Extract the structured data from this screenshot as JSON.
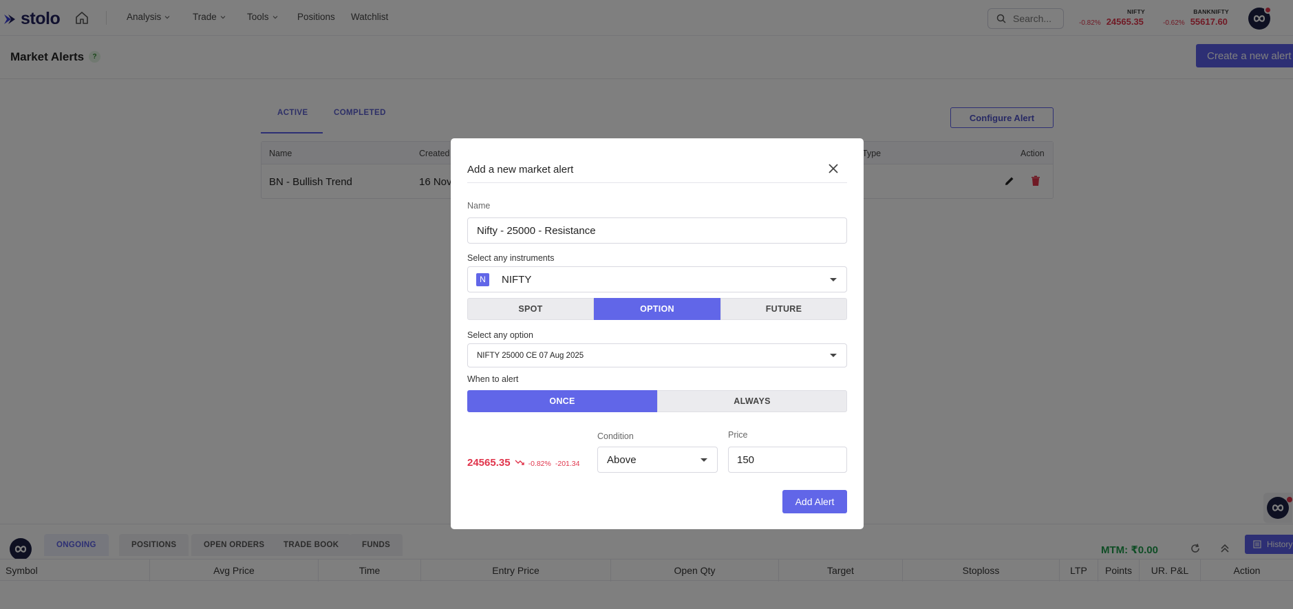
{
  "nav": {
    "brand": "stolo",
    "menu": [
      {
        "label": "Analysis",
        "has_dropdown": true
      },
      {
        "label": "Trade",
        "has_dropdown": true
      },
      {
        "label": "Tools",
        "has_dropdown": true
      },
      {
        "label": "Positions",
        "has_dropdown": false
      },
      {
        "label": "Watchlist",
        "has_dropdown": false
      }
    ],
    "search_placeholder": "Search...",
    "tickers": [
      {
        "name": "NIFTY",
        "change_pct": "-0.82%",
        "value": "24565.35"
      },
      {
        "name": "BANKNIFTY",
        "change_pct": "-0.62%",
        "value": "55617.60"
      }
    ]
  },
  "page": {
    "title": "Market Alerts",
    "help": "?",
    "create_button": "Create a new alert"
  },
  "alerts": {
    "tabs": [
      "ACTIVE",
      "COMPLETED"
    ],
    "active_tab": "ACTIVE",
    "configure_button": "Configure Alert",
    "columns": [
      "Name",
      "Created",
      "Type",
      "Action"
    ],
    "rows": [
      {
        "name": "BN - Bullish Trend",
        "created": "16 Nov"
      }
    ]
  },
  "modal": {
    "title": "Add a new market alert",
    "name_label": "Name",
    "name_value": "Nifty - 25000 - Resistance",
    "instrument_label": "Select any instruments",
    "instrument_badge": "N",
    "instrument_value": "NIFTY",
    "segments": [
      "SPOT",
      "OPTION",
      "FUTURE"
    ],
    "segment_selected": "OPTION",
    "option_label": "Select any option",
    "option_value": "NIFTY 25000 CE 07 Aug 2025",
    "when_label": "When to alert",
    "when_options": [
      "ONCE",
      "ALWAYS"
    ],
    "when_selected": "ONCE",
    "spot_price": "24565.35",
    "spot_change_pct": "-0.82%",
    "spot_change": "-201.34",
    "condition_label": "Condition",
    "condition_value": "Above",
    "price_label": "Price",
    "price_value": "150",
    "submit_button": "Add Alert"
  },
  "dock": {
    "tabs": [
      "ONGOING",
      "POSITIONS",
      "OPEN ORDERS",
      "TRADE BOOK",
      "FUNDS"
    ],
    "active_tab": "ONGOING",
    "mtm": "MTM: ₹0.00",
    "history_button": "History",
    "columns": [
      "Symbol",
      "Avg Price",
      "Time",
      "Entry Price",
      "Open Qty",
      "Target",
      "Stoploss",
      "LTP",
      "Points",
      "UR. P&L",
      "Action"
    ]
  },
  "colors": {
    "accent": "#5b5fe8",
    "negative": "#e0344b",
    "positive": "#1e9b4b",
    "brand_dark": "#23235e"
  }
}
